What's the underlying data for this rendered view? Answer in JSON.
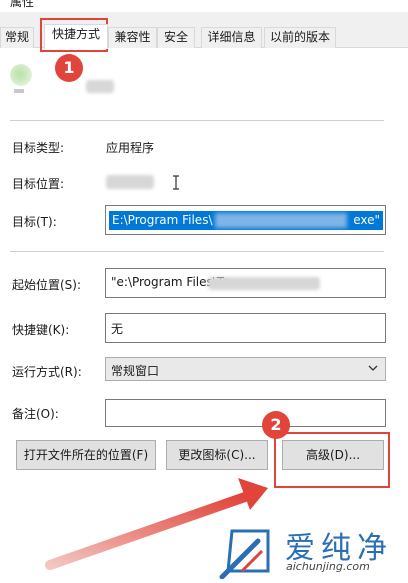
{
  "window": {
    "title": "属性"
  },
  "tabs": [
    {
      "label": "常规",
      "active": false
    },
    {
      "label": "快捷方式",
      "active": true
    },
    {
      "label": "兼容性",
      "active": false
    },
    {
      "label": "安全",
      "active": false
    },
    {
      "label": "详细信息",
      "active": false
    },
    {
      "label": "以前的版本",
      "active": false
    }
  ],
  "shortcut": {
    "target_type_label": "目标类型:",
    "target_type_value": "应用程序",
    "target_location_label": "目标位置:",
    "target_label": "目标(T):",
    "target_value_start": "E:\\Program Files\\",
    "target_value_end": "exe\"",
    "start_in_label": "起始位置(S):",
    "start_in_value": "\"e:\\Program Files\\Te",
    "hotkey_label": "快捷键(K):",
    "hotkey_value": "无",
    "run_label": "运行方式(R):",
    "run_value": "常规窗口",
    "comment_label": "备注(O):",
    "comment_value": ""
  },
  "buttons": {
    "open_location": "打开文件所在的位置(F)",
    "change_icon": "更改图标(C)...",
    "advanced": "高级(D)..."
  },
  "annotations": {
    "step1": "1",
    "step2": "2",
    "color": "#e0443a"
  },
  "watermark": {
    "cn": "爱纯净",
    "en": "aichunjing.com",
    "color": "#2a6fb4"
  },
  "icons": [
    "app-icon",
    "chevron-down-icon",
    "text-cursor-icon",
    "watermark-logo-icon"
  ]
}
